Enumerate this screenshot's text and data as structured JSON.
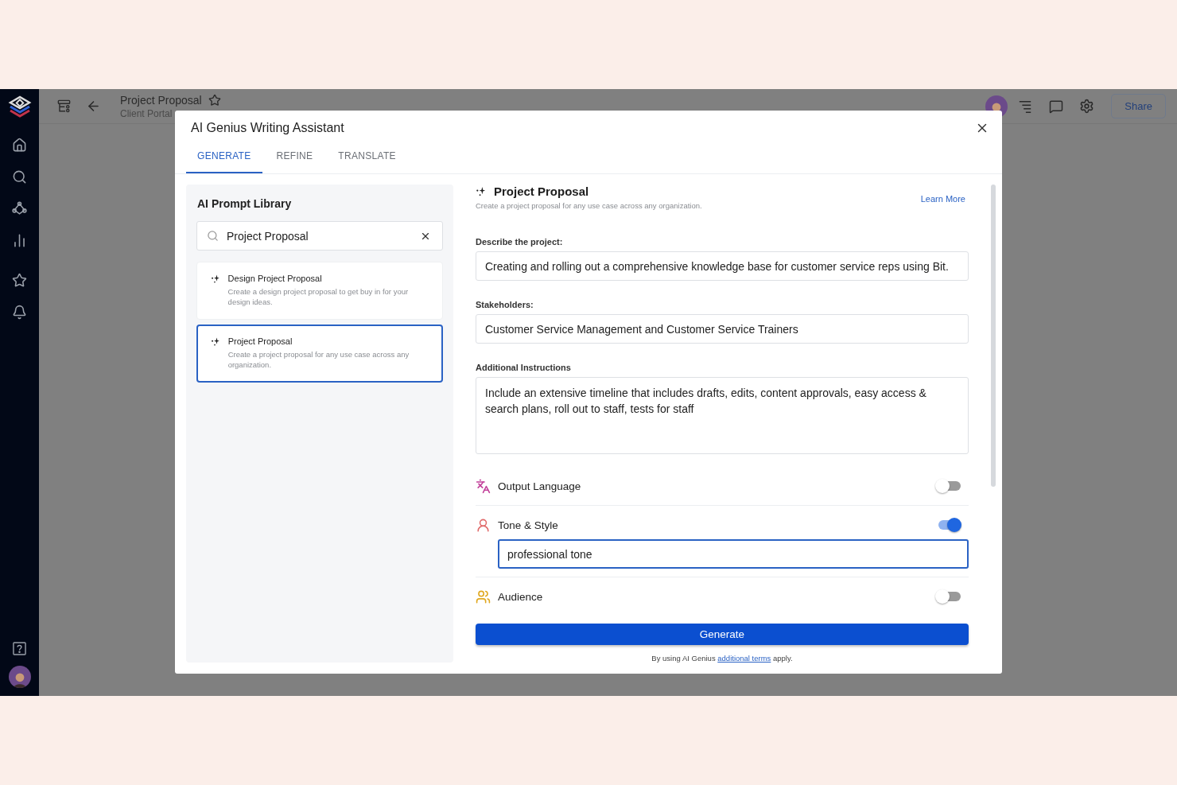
{
  "app_header": {
    "title": "Project Proposal",
    "subtitle": "Client Portal",
    "share": "Share"
  },
  "modal": {
    "title": "AI Genius Writing Assistant",
    "tabs": [
      {
        "label": "GENERATE",
        "selected": true
      },
      {
        "label": "REFINE",
        "selected": false
      },
      {
        "label": "TRANSLATE",
        "selected": false
      }
    ],
    "library": {
      "title": "AI Prompt Library",
      "search": {
        "value": "Project Proposal"
      },
      "prompts": [
        {
          "title": "Design Project Proposal",
          "description": "Create a design project proposal to get buy in for your design ideas.",
          "selected": false
        },
        {
          "title": "Project Proposal",
          "description": "Create a project proposal for any use case across any organization.",
          "selected": true
        }
      ]
    },
    "form": {
      "title": "Project Proposal",
      "description": "Create a project proposal for any use case across any organization.",
      "learn_more": "Learn More",
      "fields": [
        {
          "label": "Describe the project:",
          "value": "Creating and rolling out a comprehensive knowledge base for customer service reps using Bit.",
          "kind": "input"
        },
        {
          "label": "Stakeholders:",
          "value": "Customer Service Management and Customer Service Trainers",
          "kind": "input"
        },
        {
          "label": "Additional Instructions",
          "value": "Include an extensive timeline that includes drafts, edits, content approvals, easy access & search plans, roll out to staff, tests for staff",
          "kind": "textarea"
        }
      ],
      "options": [
        {
          "kind": "language",
          "label": "Output Language",
          "on": false
        },
        {
          "kind": "tone",
          "label": "Tone & Style",
          "on": true,
          "value": "professional tone"
        },
        {
          "kind": "audience",
          "label": "Audience",
          "on": false
        }
      ],
      "generate": "Generate",
      "footnote": {
        "before": "By using AI Genius",
        "link": "additional terms",
        "after": "apply."
      }
    }
  }
}
